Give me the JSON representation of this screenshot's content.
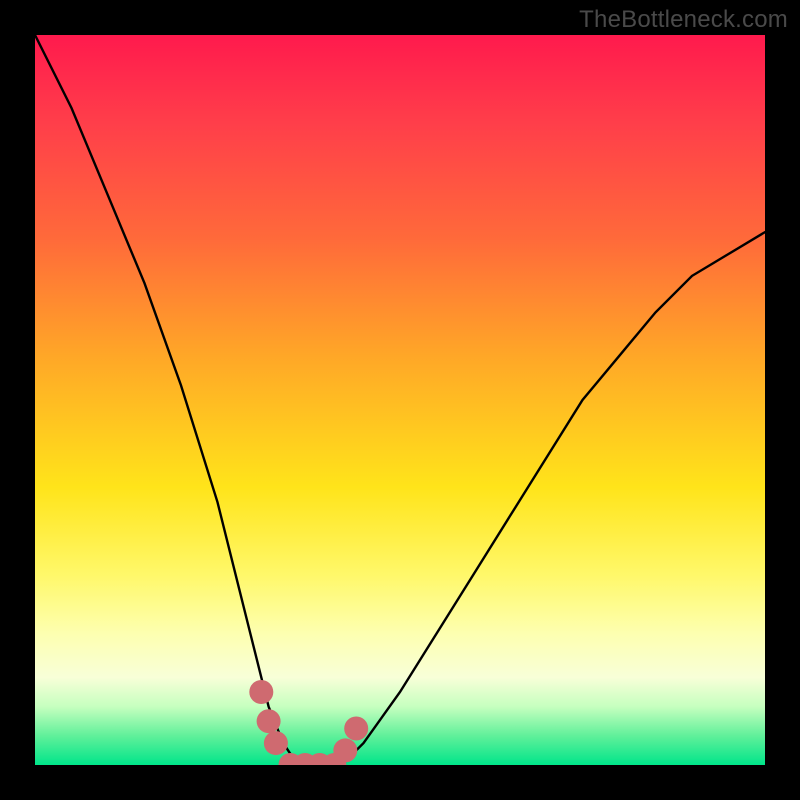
{
  "watermark": "TheBottleneck.com",
  "chart_data": {
    "type": "line",
    "title": "",
    "xlabel": "",
    "ylabel": "",
    "xlim": [
      0,
      100
    ],
    "ylim": [
      0,
      100
    ],
    "grid": false,
    "legend": false,
    "annotations": [],
    "series": [
      {
        "name": "curve",
        "x": [
          0,
          5,
          10,
          15,
          20,
          25,
          28,
          30,
          32,
          34,
          36,
          38,
          40,
          42,
          45,
          50,
          55,
          60,
          65,
          70,
          75,
          80,
          85,
          90,
          95,
          100
        ],
        "values": [
          100,
          90,
          78,
          66,
          52,
          36,
          24,
          16,
          8,
          3,
          0,
          0,
          0,
          0,
          3,
          10,
          18,
          26,
          34,
          42,
          50,
          56,
          62,
          67,
          70,
          73
        ]
      }
    ],
    "highlight": {
      "name": "bottom-dots",
      "color": "#cf6a70",
      "points": [
        {
          "x": 31,
          "y": 10
        },
        {
          "x": 32,
          "y": 6
        },
        {
          "x": 33,
          "y": 3
        },
        {
          "x": 35,
          "y": 0
        },
        {
          "x": 37,
          "y": 0
        },
        {
          "x": 39,
          "y": 0
        },
        {
          "x": 41,
          "y": 0
        },
        {
          "x": 42.5,
          "y": 2
        },
        {
          "x": 44,
          "y": 5
        }
      ]
    }
  }
}
